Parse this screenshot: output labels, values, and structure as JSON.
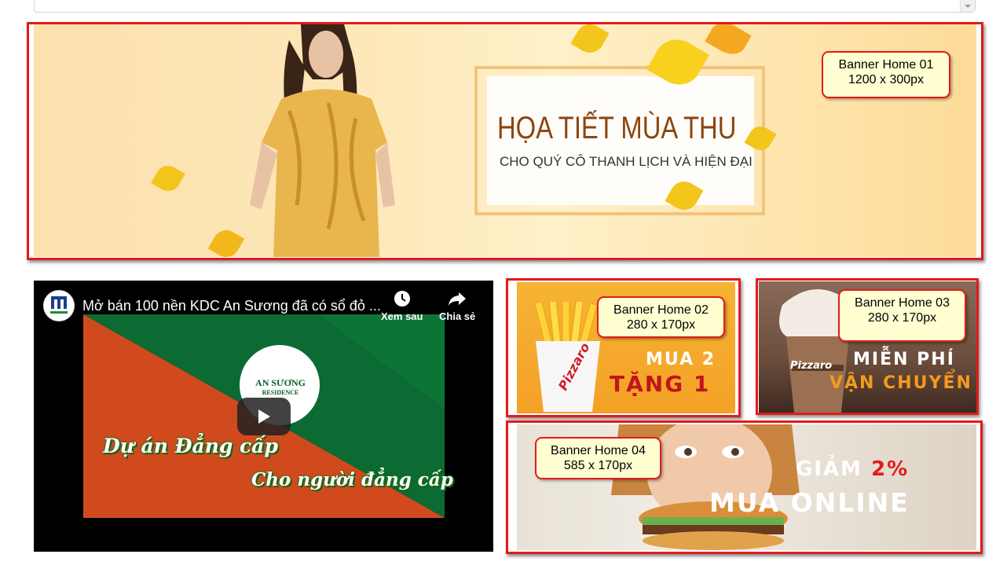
{
  "banners": {
    "home01": {
      "label_name": "Banner Home 01",
      "label_size": "1200 x 300px",
      "title": "HỌA TIẾT MÙA THU",
      "subtitle": "CHO QUÝ CÔ THANH LỊCH VÀ HIỆN ĐẠI"
    },
    "home02": {
      "label_name": "Banner Home 02",
      "label_size": "280 x 170px",
      "brand": "Pizzaro",
      "line1": "MUA 2",
      "line2": "TẶNG 1"
    },
    "home03": {
      "label_name": "Banner Home 03",
      "label_size": "280 x 170px",
      "brand": "Pizzaro",
      "line1": "MIỄN PHÍ",
      "line2": "VẬN CHUYỂN"
    },
    "home04": {
      "label_name": "Banner Home 04",
      "label_size": "585 x 170px",
      "line1_prefix": "GIẢM",
      "line1_value": "2%",
      "line2": "MUA ONLINE"
    }
  },
  "video": {
    "title": "Mở bán 100 nền KDC An Sương đã có sổ đỏ ...",
    "watch_later": "Xem sau",
    "share": "Chia sẻ",
    "logo_name": "AN SƯƠNG",
    "logo_sub": "RESIDENCE",
    "text1": "Dự án Đẳng cấp",
    "text2": "Cho người đẳng cấp"
  },
  "colors": {
    "frame": "#e31b1b",
    "label_bg": "#ffffd2"
  }
}
